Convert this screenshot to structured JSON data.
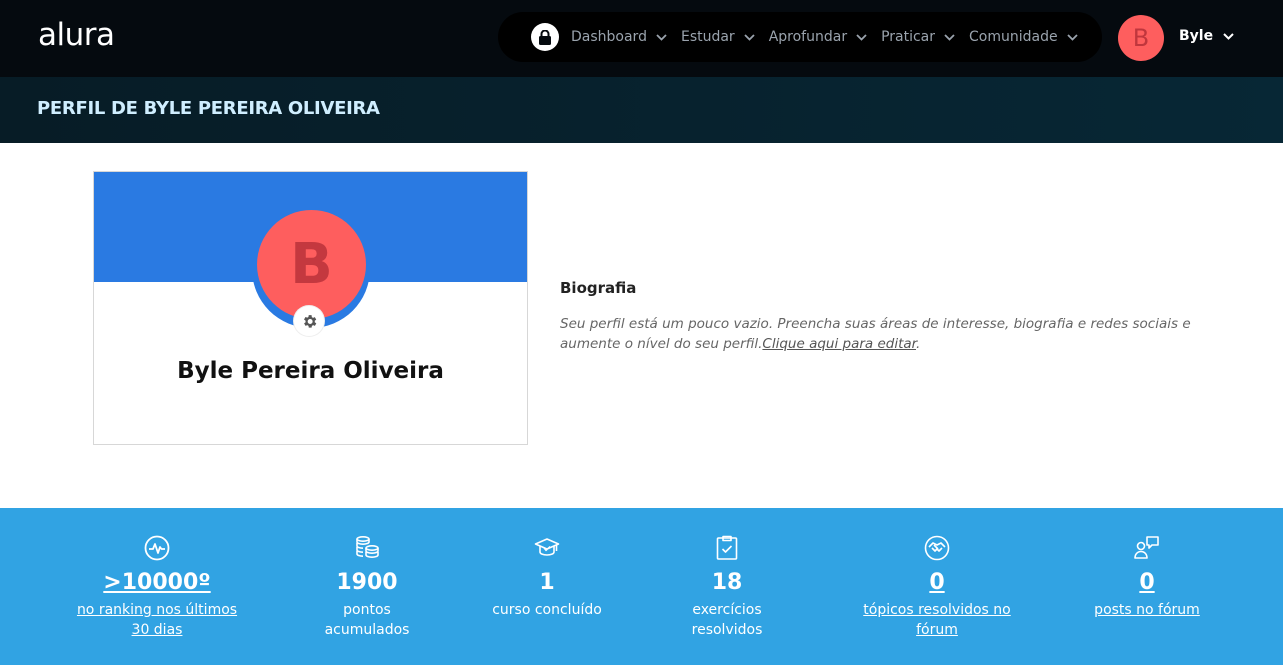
{
  "brand": {
    "logo": "alura",
    "accent": "#2a7ae2",
    "avatar_color": "#fe5e5e",
    "stats_bg": "#31a3e3"
  },
  "nav": {
    "lock_icon": "lock-icon",
    "items": [
      {
        "label": "Dashboard"
      },
      {
        "label": "Estudar"
      },
      {
        "label": "Aprofundar"
      },
      {
        "label": "Praticar"
      },
      {
        "label": "Comunidade"
      }
    ]
  },
  "user": {
    "initial": "B",
    "name": "Byle"
  },
  "header": {
    "title": "PERFIL DE BYLE PEREIRA OLIVEIRA"
  },
  "profile": {
    "initial": "B",
    "full_name": "Byle Pereira Oliveira",
    "settings_icon": "gear-icon"
  },
  "bio": {
    "heading": "Biografia",
    "text": "Seu perfil está um pouco vazio. Preencha suas áreas de interesse, biografia e redes sociais e aumente o nível do seu perfil.",
    "link": "Clique aqui para editar",
    "suffix": "."
  },
  "stats": [
    {
      "icon": "activity-icon",
      "value": ">10000º",
      "label_l1": "no ranking nos últimos",
      "label_l2": "30 dias"
    },
    {
      "icon": "coins-icon",
      "value": "1900",
      "label_l1": "pontos",
      "label_l2": "acumulados"
    },
    {
      "icon": "graduation-cap-icon",
      "value": "1",
      "label_l1": "curso concluído",
      "label_l2": ""
    },
    {
      "icon": "clipboard-check-icon",
      "value": "18",
      "label_l1": "exercícios",
      "label_l2": "resolvidos"
    },
    {
      "icon": "handshake-icon",
      "value": "0",
      "label_l1": "tópicos resolvidos no",
      "label_l2": "fórum"
    },
    {
      "icon": "forum-user-icon",
      "value": "0",
      "label_l1": "posts no fórum",
      "label_l2": ""
    }
  ]
}
